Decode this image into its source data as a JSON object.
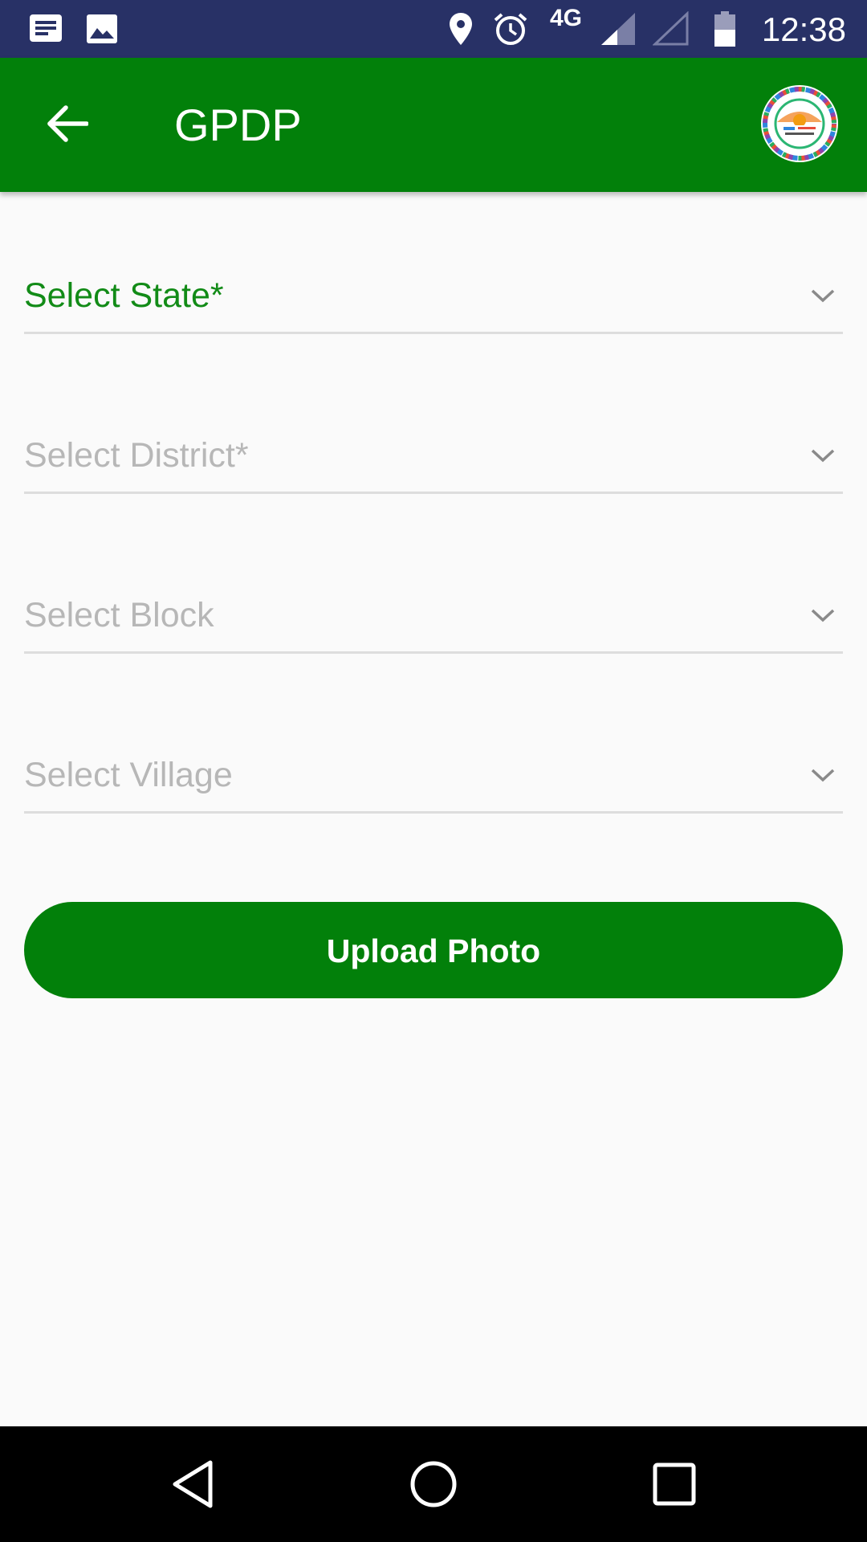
{
  "status_bar": {
    "time": "12:38",
    "network": "4G",
    "icons": [
      "notification-message-icon",
      "gallery-icon",
      "location-icon",
      "alarm-icon",
      "signal-icon",
      "signal-empty-icon",
      "battery-icon"
    ]
  },
  "app_bar": {
    "title": "GPDP",
    "back_icon": "arrow-left-icon",
    "logo": "gpdp-emblem-logo"
  },
  "form": {
    "fields": [
      {
        "label": "Select State*",
        "active": true
      },
      {
        "label": "Select District*",
        "active": false
      },
      {
        "label": "Select Block",
        "active": false
      },
      {
        "label": "Select Village",
        "active": false
      }
    ],
    "upload_button": "Upload Photo"
  },
  "colors": {
    "status_bar": "#283166",
    "primary": "#02800a",
    "active_label": "#128b17",
    "placeholder": "#b7b7b7",
    "background": "#fafafa"
  },
  "nav_bar": {
    "icons": [
      "back-triangle-icon",
      "home-circle-icon",
      "recents-square-icon"
    ]
  }
}
